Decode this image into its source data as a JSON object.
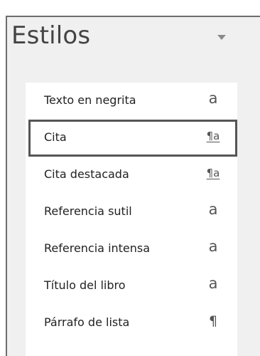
{
  "pane": {
    "title": "Estilos",
    "dropdown_icon": "triangle-down-icon"
  },
  "styles": [
    {
      "name": "Texto en negrita",
      "glyph": "a",
      "glyph_type": "character"
    },
    {
      "name": "Cita",
      "glyph": "¶a",
      "glyph_type": "linked",
      "selected": true
    },
    {
      "name": "Cita destacada",
      "glyph": "¶a",
      "glyph_type": "linked"
    },
    {
      "name": "Referencia sutil",
      "glyph": "a",
      "glyph_type": "character"
    },
    {
      "name": "Referencia intensa",
      "glyph": "a",
      "glyph_type": "character"
    },
    {
      "name": "Título del libro",
      "glyph": "a",
      "glyph_type": "character"
    },
    {
      "name": "Párrafo de lista",
      "glyph": "¶",
      "glyph_type": "paragraph"
    }
  ],
  "colors": {
    "pane_background": "#f0f0f0",
    "list_background": "#ffffff",
    "selection_border": "#555555"
  }
}
